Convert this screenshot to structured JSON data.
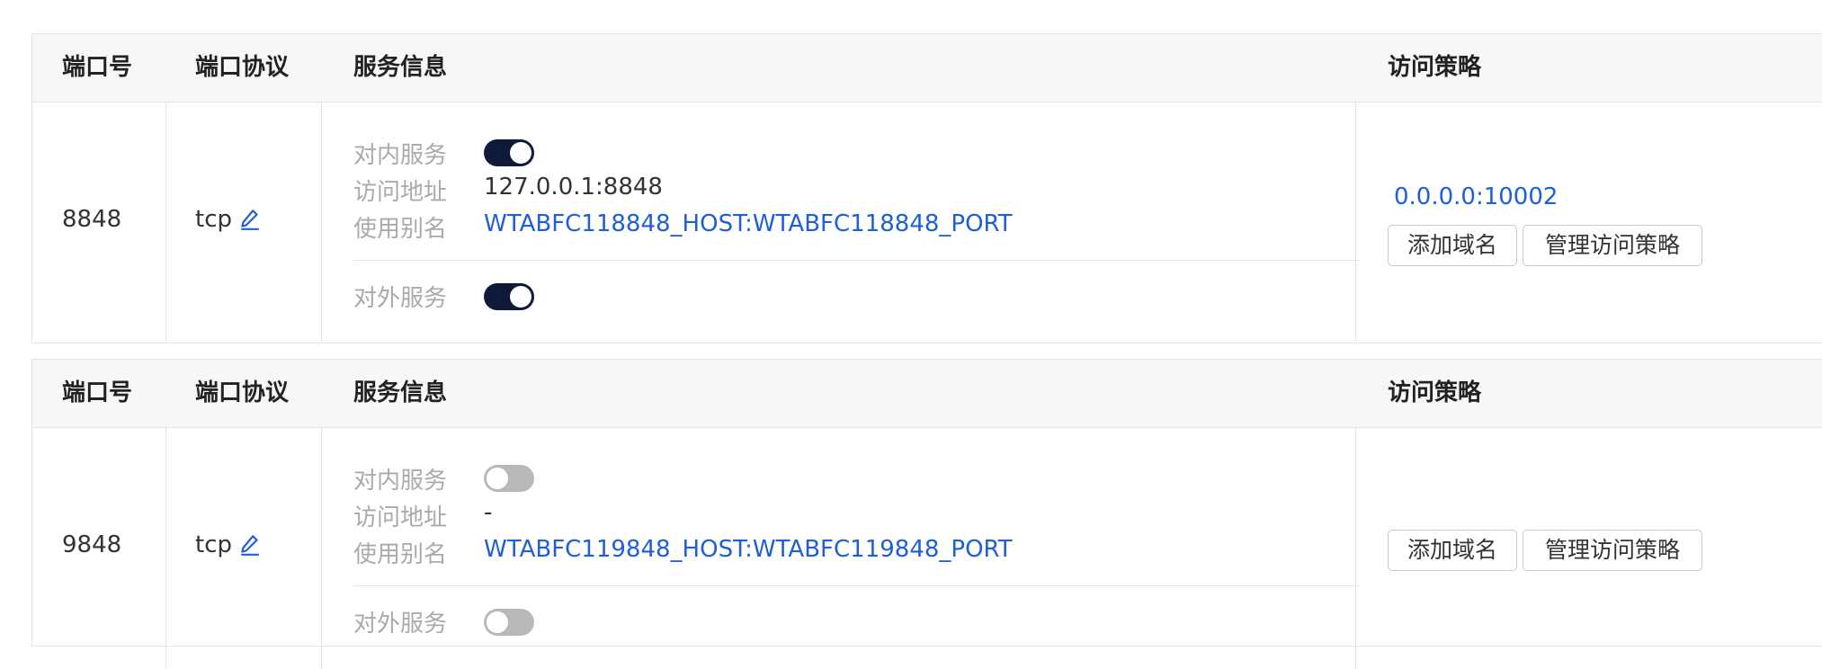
{
  "headers": {
    "port": "端口号",
    "protocol": "端口协议",
    "service": "服务信息",
    "policy": "访问策略"
  },
  "labels": {
    "internal_service": "对内服务",
    "access_address": "访问地址",
    "alias": "使用别名",
    "external_service": "对外服务",
    "add_domain": "添加域名",
    "manage_policy": "管理访问策略"
  },
  "ports": [
    {
      "port": "8848",
      "protocol": "tcp",
      "internal_enabled": true,
      "access_address": "127.0.0.1:8848",
      "alias": "WTABFC118848_HOST:WTABFC118848_PORT",
      "external_enabled": true,
      "policy_address": "0.0.0.0:10002"
    },
    {
      "port": "9848",
      "protocol": "tcp",
      "internal_enabled": false,
      "access_address": "-",
      "alias": "WTABFC119848_HOST:WTABFC119848_PORT",
      "external_enabled": false,
      "policy_address": ""
    }
  ],
  "colors": {
    "link": "#1f5fd6",
    "toggle_on": "#0f1a3a",
    "toggle_off": "#b9b9b9",
    "header_bg": "#f7f7f7",
    "border": "#e3e3e3"
  },
  "icons": {
    "edit": "edit-pencil-icon"
  }
}
